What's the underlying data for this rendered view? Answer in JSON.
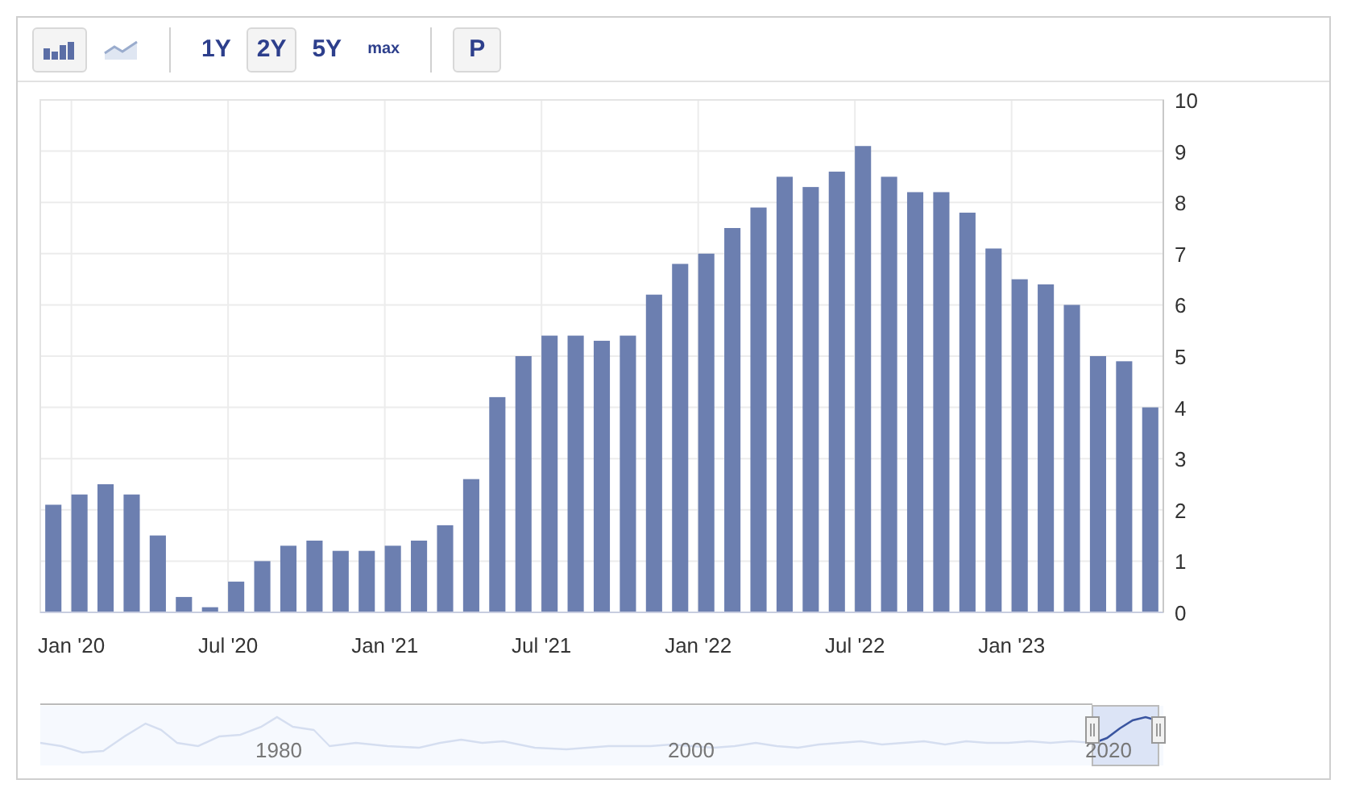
{
  "toolbar": {
    "chart_types": [
      {
        "kind": "bar",
        "selected": true
      },
      {
        "kind": "line",
        "selected": false
      }
    ],
    "ranges": [
      {
        "label": "1Y",
        "selected": false
      },
      {
        "label": "2Y",
        "selected": true
      },
      {
        "label": "5Y",
        "selected": false
      },
      {
        "label": "max",
        "selected": false
      }
    ],
    "extra_button": "P"
  },
  "chart": {
    "chart_data": {
      "type": "bar",
      "grid": true,
      "series": [
        {
          "color": "#6c7fb0",
          "values": [
            2.1,
            2.3,
            2.5,
            2.3,
            1.5,
            0.3,
            0.1,
            0.6,
            1.0,
            1.3,
            1.4,
            1.2,
            1.2,
            1.3,
            1.4,
            1.7,
            2.6,
            4.2,
            5.0,
            5.4,
            5.4,
            5.3,
            5.4,
            6.2,
            6.8,
            7.0,
            7.5,
            7.9,
            8.5,
            8.3,
            8.6,
            9.1,
            8.5,
            8.2,
            8.2,
            7.8,
            7.1,
            6.5,
            6.4,
            6.0,
            5.0,
            4.9,
            4.0
          ]
        }
      ],
      "ylim": [
        0,
        10
      ],
      "categories": [
        null,
        "Jan '20",
        null,
        null,
        null,
        null,
        null,
        "Jul '20",
        null,
        null,
        null,
        null,
        null,
        "Jan '21",
        null,
        null,
        null,
        null,
        null,
        "Jul '21",
        null,
        null,
        null,
        null,
        null,
        "Jan '22",
        null,
        null,
        null,
        null,
        null,
        "Jul '22",
        null,
        null,
        null,
        null,
        null,
        "Jan '23",
        null,
        null,
        null,
        null,
        null
      ],
      "yticks": [
        0,
        1,
        2,
        3,
        4,
        5,
        6,
        7,
        8,
        9,
        10
      ]
    }
  },
  "navigator": {
    "year_labels": [
      "1980",
      "2000",
      "2020"
    ]
  }
}
